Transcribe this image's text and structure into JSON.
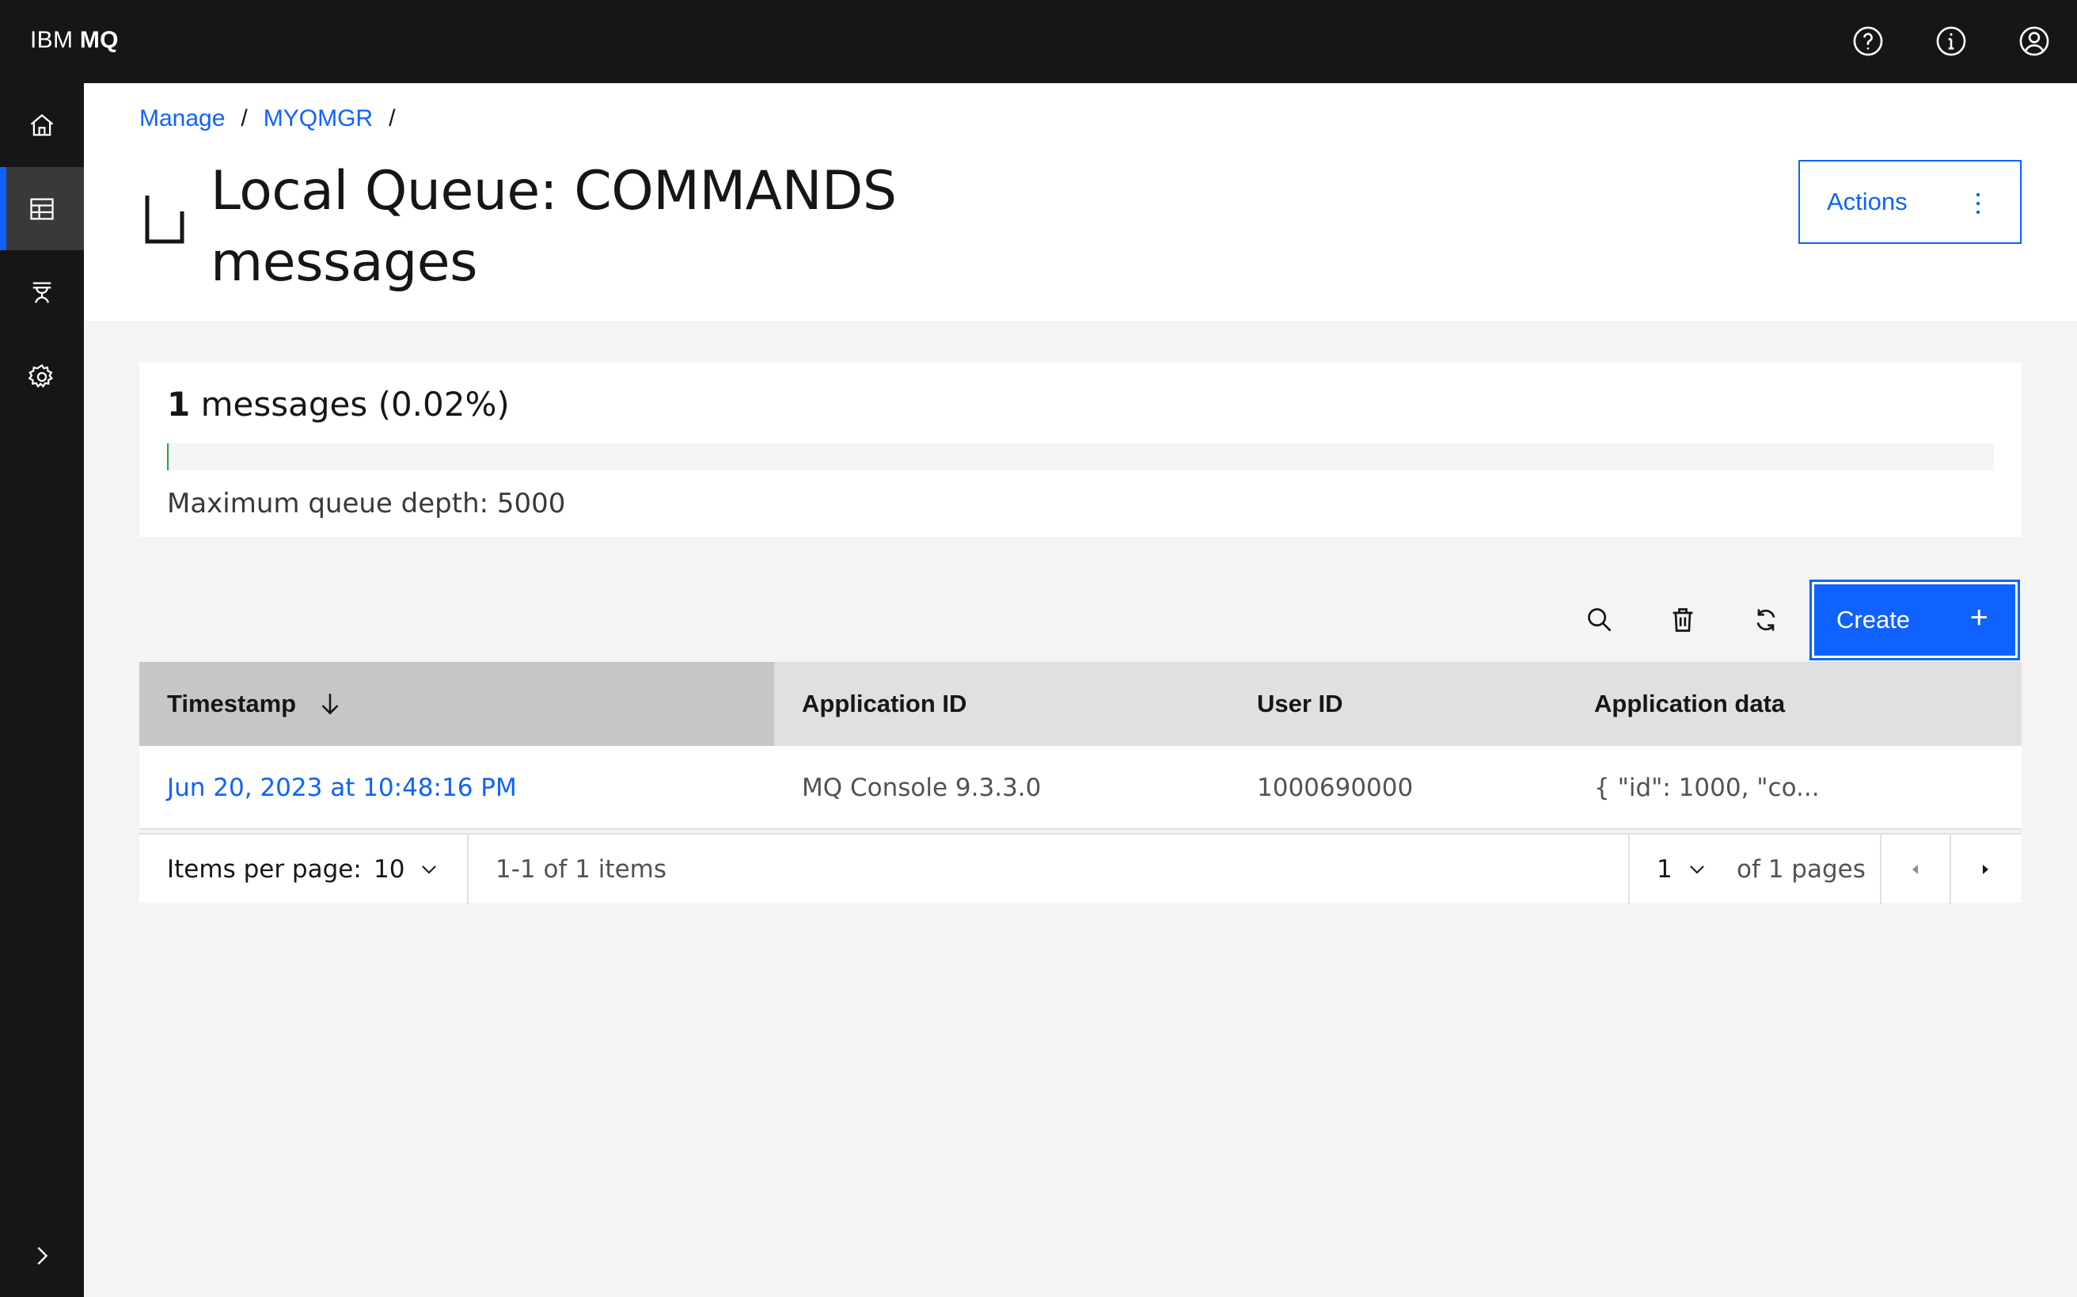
{
  "header": {
    "brand_prefix": "IBM",
    "brand_product": "MQ",
    "icons": [
      "help-icon",
      "info-icon",
      "user-avatar-icon"
    ]
  },
  "sidenav": {
    "items": [
      {
        "name": "home",
        "icon": "home-icon"
      },
      {
        "name": "manage",
        "icon": "table-icon",
        "active": true
      },
      {
        "name": "applications",
        "icon": "app-icon"
      },
      {
        "name": "settings",
        "icon": "gear-icon"
      }
    ],
    "expand_icon": "chevron-right-icon"
  },
  "breadcrumb": {
    "items": [
      "Manage",
      "MYQMGR"
    ],
    "separator": "/"
  },
  "page": {
    "title_line1": "Local Queue: COMMANDS",
    "title_line2": "messages",
    "actions_label": "Actions"
  },
  "summary": {
    "count": "1",
    "count_suffix": " messages (0.02%)",
    "depth_fraction": 0.0002,
    "max_depth_label": "Maximum queue depth: 5000"
  },
  "toolbar": {
    "icons": [
      "search-icon",
      "trash-icon",
      "refresh-icon"
    ],
    "create_label": "Create",
    "create_icon": "+"
  },
  "table": {
    "columns": [
      "Timestamp",
      "Application ID",
      "User ID",
      "Application data"
    ],
    "sorted_column": "Timestamp",
    "rows": [
      {
        "timestamp": "Jun 20, 2023 at 10:48:16 PM",
        "application_id": "MQ Console 9.3.3.0",
        "user_id": "1000690000",
        "application_data": "{ \"id\": 1000, \"co..."
      }
    ]
  },
  "pagination": {
    "items_per_page_label": "Items per page:",
    "items_per_page_value": "10",
    "range_label": "1-1 of 1 items",
    "current_page": "1",
    "pages_label": "of 1 pages"
  },
  "colors": {
    "brand_blue": "#0f62fe",
    "header_bg": "#161616",
    "progress_green": "#24a148"
  }
}
